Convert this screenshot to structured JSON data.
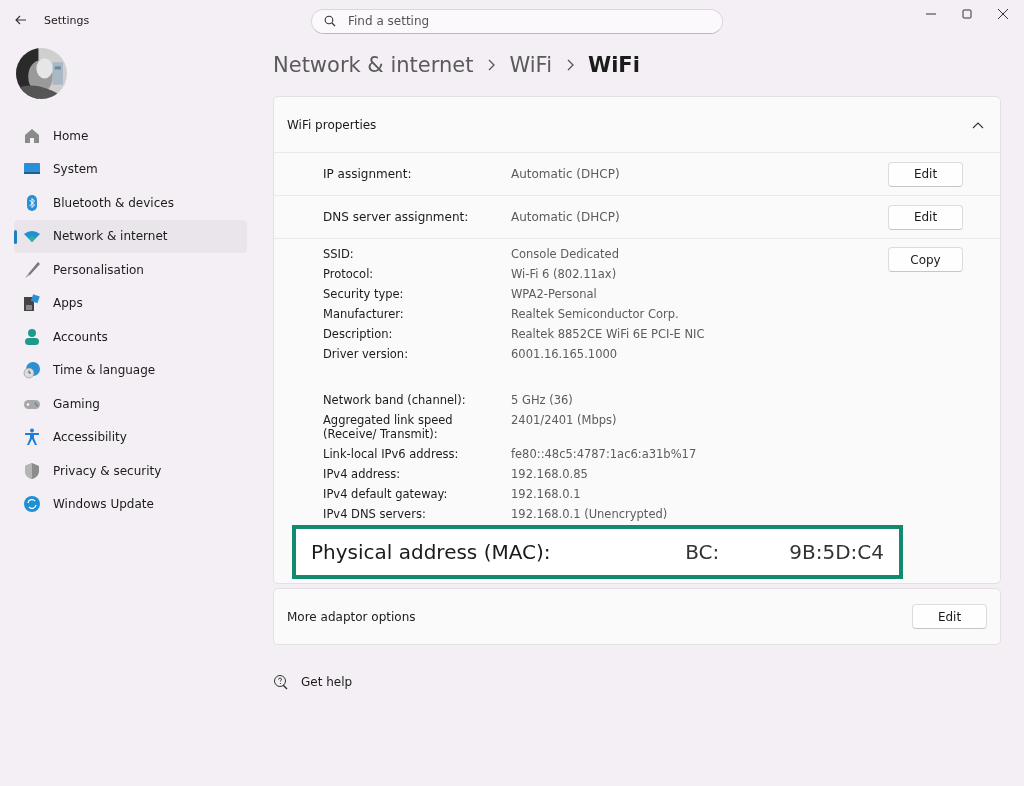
{
  "window": {
    "title": "Settings",
    "search": {
      "placeholder": "Find a setting"
    }
  },
  "sidebar": {
    "items": [
      {
        "label": "Home",
        "kind": "home",
        "selected": false
      },
      {
        "label": "System",
        "kind": "system",
        "selected": false
      },
      {
        "label": "Bluetooth & devices",
        "kind": "bluetooth",
        "selected": false
      },
      {
        "label": "Network & internet",
        "kind": "network",
        "selected": true
      },
      {
        "label": "Personalisation",
        "kind": "brush",
        "selected": false
      },
      {
        "label": "Apps",
        "kind": "apps",
        "selected": false
      },
      {
        "label": "Accounts",
        "kind": "accounts",
        "selected": false
      },
      {
        "label": "Time & language",
        "kind": "time",
        "selected": false
      },
      {
        "label": "Gaming",
        "kind": "gaming",
        "selected": false
      },
      {
        "label": "Accessibility",
        "kind": "accessibility",
        "selected": false
      },
      {
        "label": "Privacy & security",
        "kind": "shield",
        "selected": false
      },
      {
        "label": "Windows Update",
        "kind": "update",
        "selected": false
      }
    ]
  },
  "breadcrumb": [
    "Network & internet",
    "WiFi",
    "WiFi"
  ],
  "properties": {
    "title": "WiFi properties",
    "expanded": true,
    "settings": [
      {
        "label": "IP assignment:",
        "value": "Automatic (DHCP)",
        "button": "Edit"
      },
      {
        "label": "DNS server assignment:",
        "value": "Automatic (DHCP)",
        "button": "Edit"
      }
    ],
    "details": {
      "button": "Copy",
      "groups": [
        [
          {
            "label": "SSID:",
            "value": "Console Dedicated"
          },
          {
            "label": "Protocol:",
            "value": "Wi-Fi 6 (802.11ax)"
          },
          {
            "label": "Security type:",
            "value": "WPA2-Personal"
          },
          {
            "label": "Manufacturer:",
            "value": "Realtek Semiconductor Corp."
          },
          {
            "label": "Description:",
            "value": "Realtek 8852CE WiFi 6E PCI-E NIC"
          },
          {
            "label": "Driver version:",
            "value": "6001.16.165.1000"
          }
        ],
        [
          {
            "label": "Network band (channel):",
            "value": "5 GHz (36)"
          },
          {
            "label": "Aggregated link speed (Receive/ Transmit):",
            "value": "2401/2401 (Mbps)"
          },
          {
            "label": "Link-local IPv6 address:",
            "value": "fe80::48c5:4787:1ac6:a31b%17"
          },
          {
            "label": "IPv4 address:",
            "value": "192.168.0.85"
          },
          {
            "label": "IPv4 default gateway:",
            "value": "192.168.0.1"
          },
          {
            "label": "IPv4 DNS servers:",
            "value": "192.168.0.1 (Unencrypted)"
          }
        ]
      ]
    },
    "highlight": {
      "label": "Physical address (MAC):",
      "value_parts": [
        "BC:",
        "9B:5D:C4"
      ]
    }
  },
  "more": {
    "label": "More adaptor options",
    "button": "Edit"
  },
  "help": "Get help"
}
